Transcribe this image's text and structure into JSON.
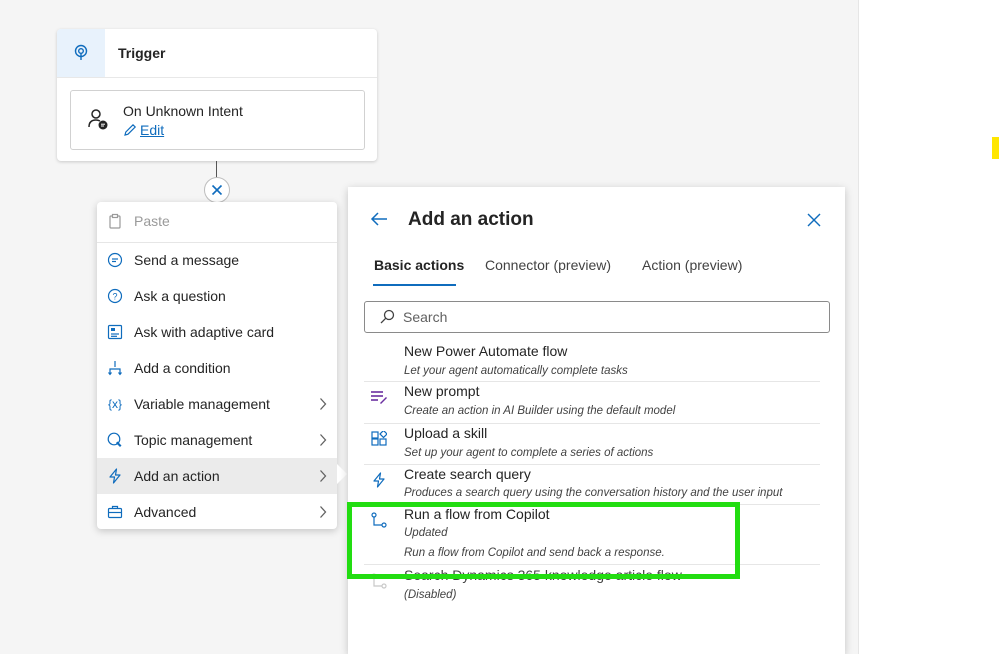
{
  "trigger": {
    "title": "Trigger",
    "intent_title": "On Unknown Intent",
    "edit_label": "Edit"
  },
  "menu": {
    "items": [
      {
        "label": "Paste",
        "icon": "paste-icon",
        "disabled": true
      },
      {
        "label": "Send a message",
        "icon": "message-icon"
      },
      {
        "label": "Ask a question",
        "icon": "question-icon"
      },
      {
        "label": "Ask with adaptive card",
        "icon": "adaptive-card-icon"
      },
      {
        "label": "Add a condition",
        "icon": "condition-icon"
      },
      {
        "label": "Variable management",
        "icon": "variable-icon",
        "submenu": true
      },
      {
        "label": "Topic management",
        "icon": "topic-icon",
        "submenu": true
      },
      {
        "label": "Add an action",
        "icon": "action-icon",
        "submenu": true,
        "active": true
      },
      {
        "label": "Advanced",
        "icon": "toolbox-icon",
        "submenu": true
      }
    ]
  },
  "panel": {
    "title": "Add an action",
    "tabs": [
      "Basic actions",
      "Connector (preview)",
      "Action (preview)"
    ],
    "search_placeholder": "Search",
    "items": [
      {
        "title": "New Power Automate flow",
        "desc": "Let your agent automatically complete tasks"
      },
      {
        "title": "New prompt",
        "desc": "Create an action in AI Builder using the default model"
      },
      {
        "title": "Upload a skill",
        "desc": "Set up your agent to complete a series of actions"
      },
      {
        "title": "Create search query",
        "desc": "Produces a search query using the conversation history and the user input"
      },
      {
        "title": "Run a flow from Copilot",
        "status": "Updated",
        "desc": "Run a flow from Copilot and send back a response."
      },
      {
        "title": "Search Dynamics 365 knowledge article flow",
        "status": "(Disabled)"
      }
    ]
  },
  "colors": {
    "accent": "#0f6cbd",
    "highlight": "#22dd11",
    "marker": "#ffe600"
  }
}
